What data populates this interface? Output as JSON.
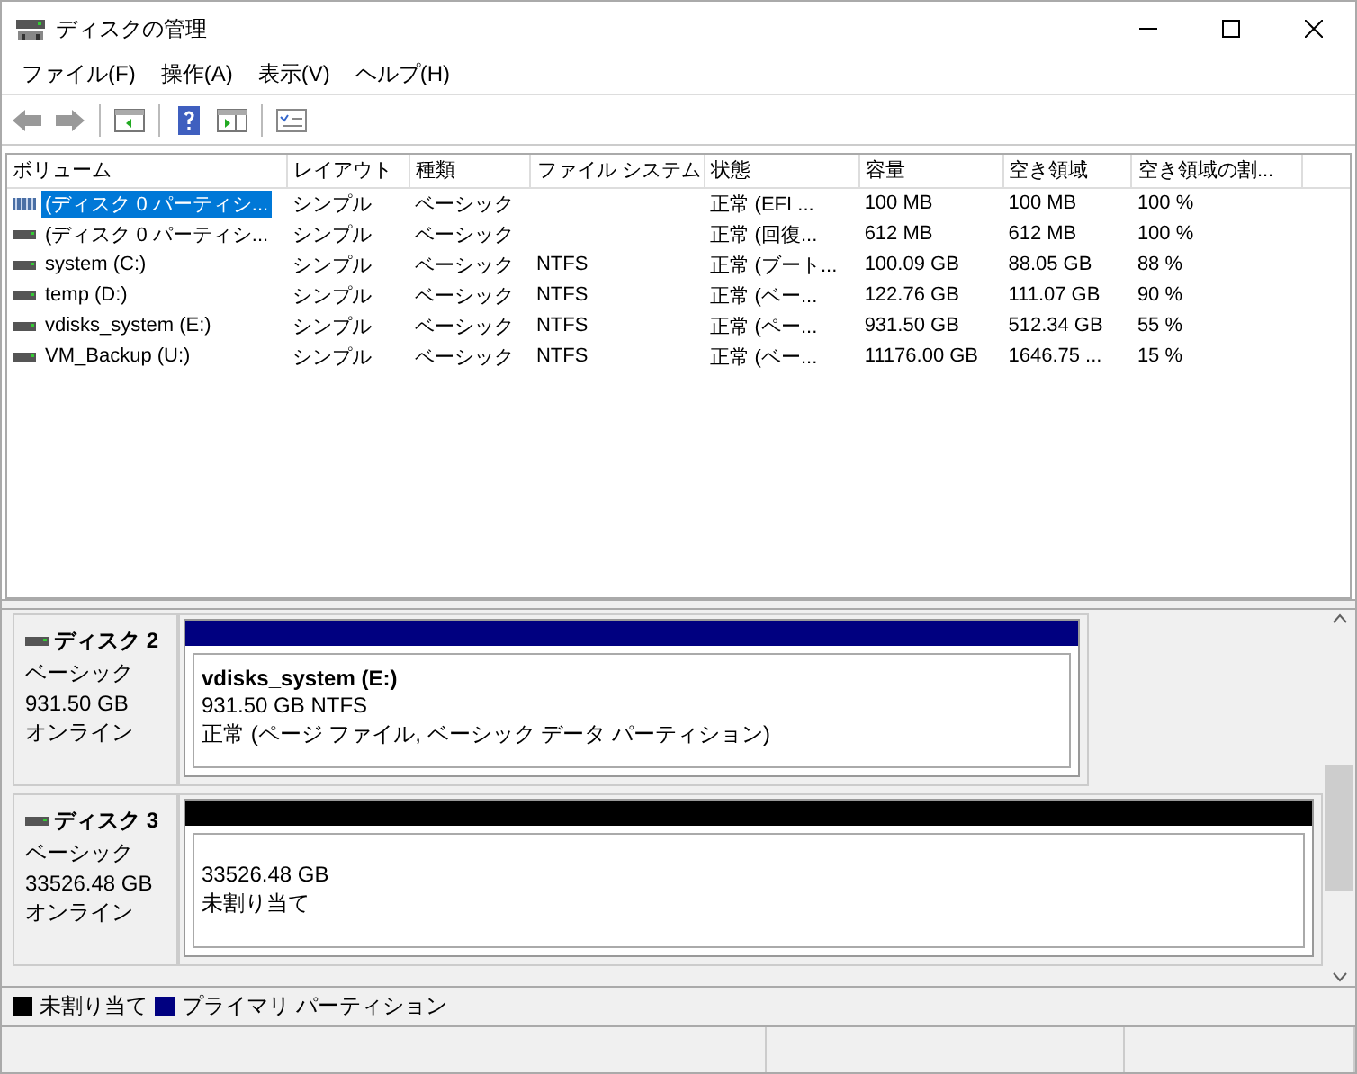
{
  "window": {
    "title": "ディスクの管理"
  },
  "menu": [
    "ファイル(F)",
    "操作(A)",
    "表示(V)",
    "ヘルプ(H)"
  ],
  "table": {
    "columns": [
      "ボリューム",
      "レイアウト",
      "種類",
      "ファイル システム",
      "状態",
      "容量",
      "空き領域",
      "空き領域の割..."
    ],
    "rows": [
      {
        "selected": true,
        "kind": "striped",
        "cells": [
          "(ディスク 0 パーティシ...",
          "シンプル",
          "ベーシック",
          "",
          "正常 (EFI ...",
          "100 MB",
          "100 MB",
          "100 %"
        ]
      },
      {
        "selected": false,
        "kind": "drive",
        "cells": [
          "(ディスク 0 パーティシ...",
          "シンプル",
          "ベーシック",
          "",
          "正常 (回復...",
          "612 MB",
          "612 MB",
          "100 %"
        ]
      },
      {
        "selected": false,
        "kind": "drive",
        "cells": [
          "system (C:)",
          "シンプル",
          "ベーシック",
          "NTFS",
          "正常 (ブート...",
          "100.09 GB",
          "88.05 GB",
          "88 %"
        ]
      },
      {
        "selected": false,
        "kind": "drive",
        "cells": [
          "temp (D:)",
          "シンプル",
          "ベーシック",
          "NTFS",
          "正常 (ベー...",
          "122.76 GB",
          "111.07 GB",
          "90 %"
        ]
      },
      {
        "selected": false,
        "kind": "drive",
        "cells": [
          "vdisks_system (E:)",
          "シンプル",
          "ベーシック",
          "NTFS",
          "正常 (ペー...",
          "931.50 GB",
          "512.34 GB",
          "55 %"
        ]
      },
      {
        "selected": false,
        "kind": "drive",
        "cells": [
          "VM_Backup (U:)",
          "シンプル",
          "ベーシック",
          "NTFS",
          "正常 (ベー...",
          "11176.00 GB",
          "1646.75 ...",
          "15 %"
        ]
      }
    ]
  },
  "disks": [
    {
      "name": "ディスク 2",
      "type": "ベーシック",
      "size": "931.50 GB",
      "status": "オンライン",
      "partitions": [
        {
          "kind": "primary",
          "label": "vdisks_system  (E:)",
          "size": "931.50 GB NTFS",
          "status": "正常 (ページ ファイル, ベーシック データ パーティション)"
        }
      ]
    },
    {
      "name": "ディスク 3",
      "type": "ベーシック",
      "size": "33526.48 GB",
      "status": "オンライン",
      "partitions": [
        {
          "kind": "unallocated",
          "size": "33526.48 GB",
          "status": "未割り当て"
        }
      ]
    }
  ],
  "legend": [
    {
      "color": "#000000",
      "label": "未割り当て"
    },
    {
      "color": "#000080",
      "label": "プライマリ パーティション"
    }
  ]
}
